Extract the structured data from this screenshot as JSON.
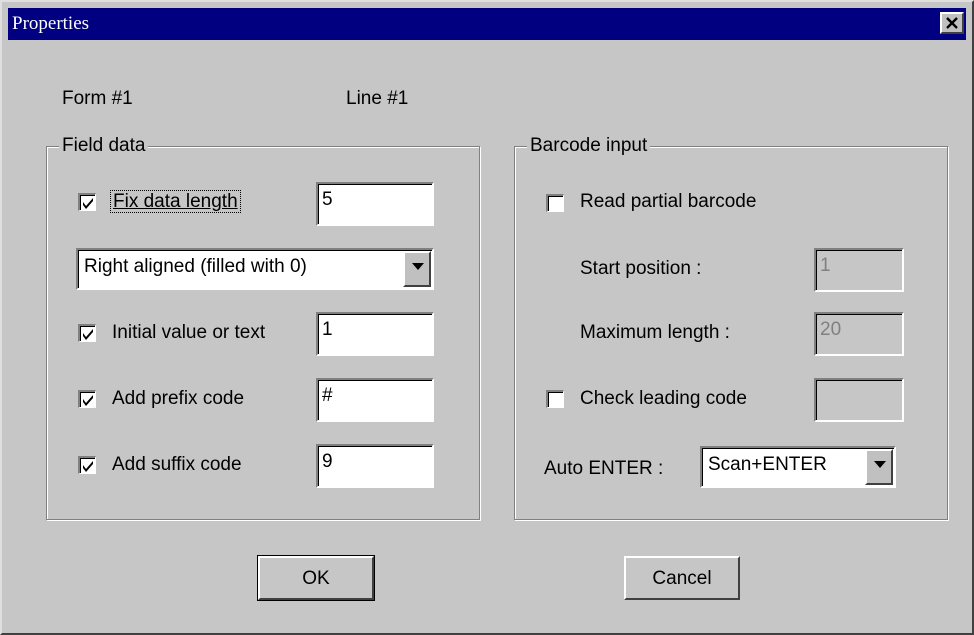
{
  "window": {
    "title": "Properties",
    "close_glyph": "✕"
  },
  "header": {
    "form_label": "Form #1",
    "line_label": "Line #1"
  },
  "field_data": {
    "legend": "Field data",
    "fix_length": {
      "label": "Fix data length",
      "checked": true,
      "value": "5"
    },
    "alignment": {
      "selected": "Right aligned (filled with 0)"
    },
    "initial_value": {
      "label": "Initial value or text",
      "checked": true,
      "value": "1"
    },
    "prefix": {
      "label": "Add prefix code",
      "checked": true,
      "value": "#"
    },
    "suffix": {
      "label": "Add suffix code",
      "checked": true,
      "value": "9"
    }
  },
  "barcode_input": {
    "legend": "Barcode input",
    "read_partial": {
      "label": "Read partial barcode",
      "checked": false
    },
    "start_position": {
      "label": "Start position :",
      "value": "1"
    },
    "max_length": {
      "label": "Maximum length :",
      "value": "20"
    },
    "leading_code": {
      "label": "Check leading code",
      "checked": false,
      "value": ""
    },
    "auto_enter": {
      "label": "Auto ENTER :",
      "selected": "Scan+ENTER"
    }
  },
  "buttons": {
    "ok": "OK",
    "cancel": "Cancel"
  },
  "colors": {
    "titlebar": "#000080",
    "face": "#c6c6c6",
    "disabled_text": "#808080"
  }
}
